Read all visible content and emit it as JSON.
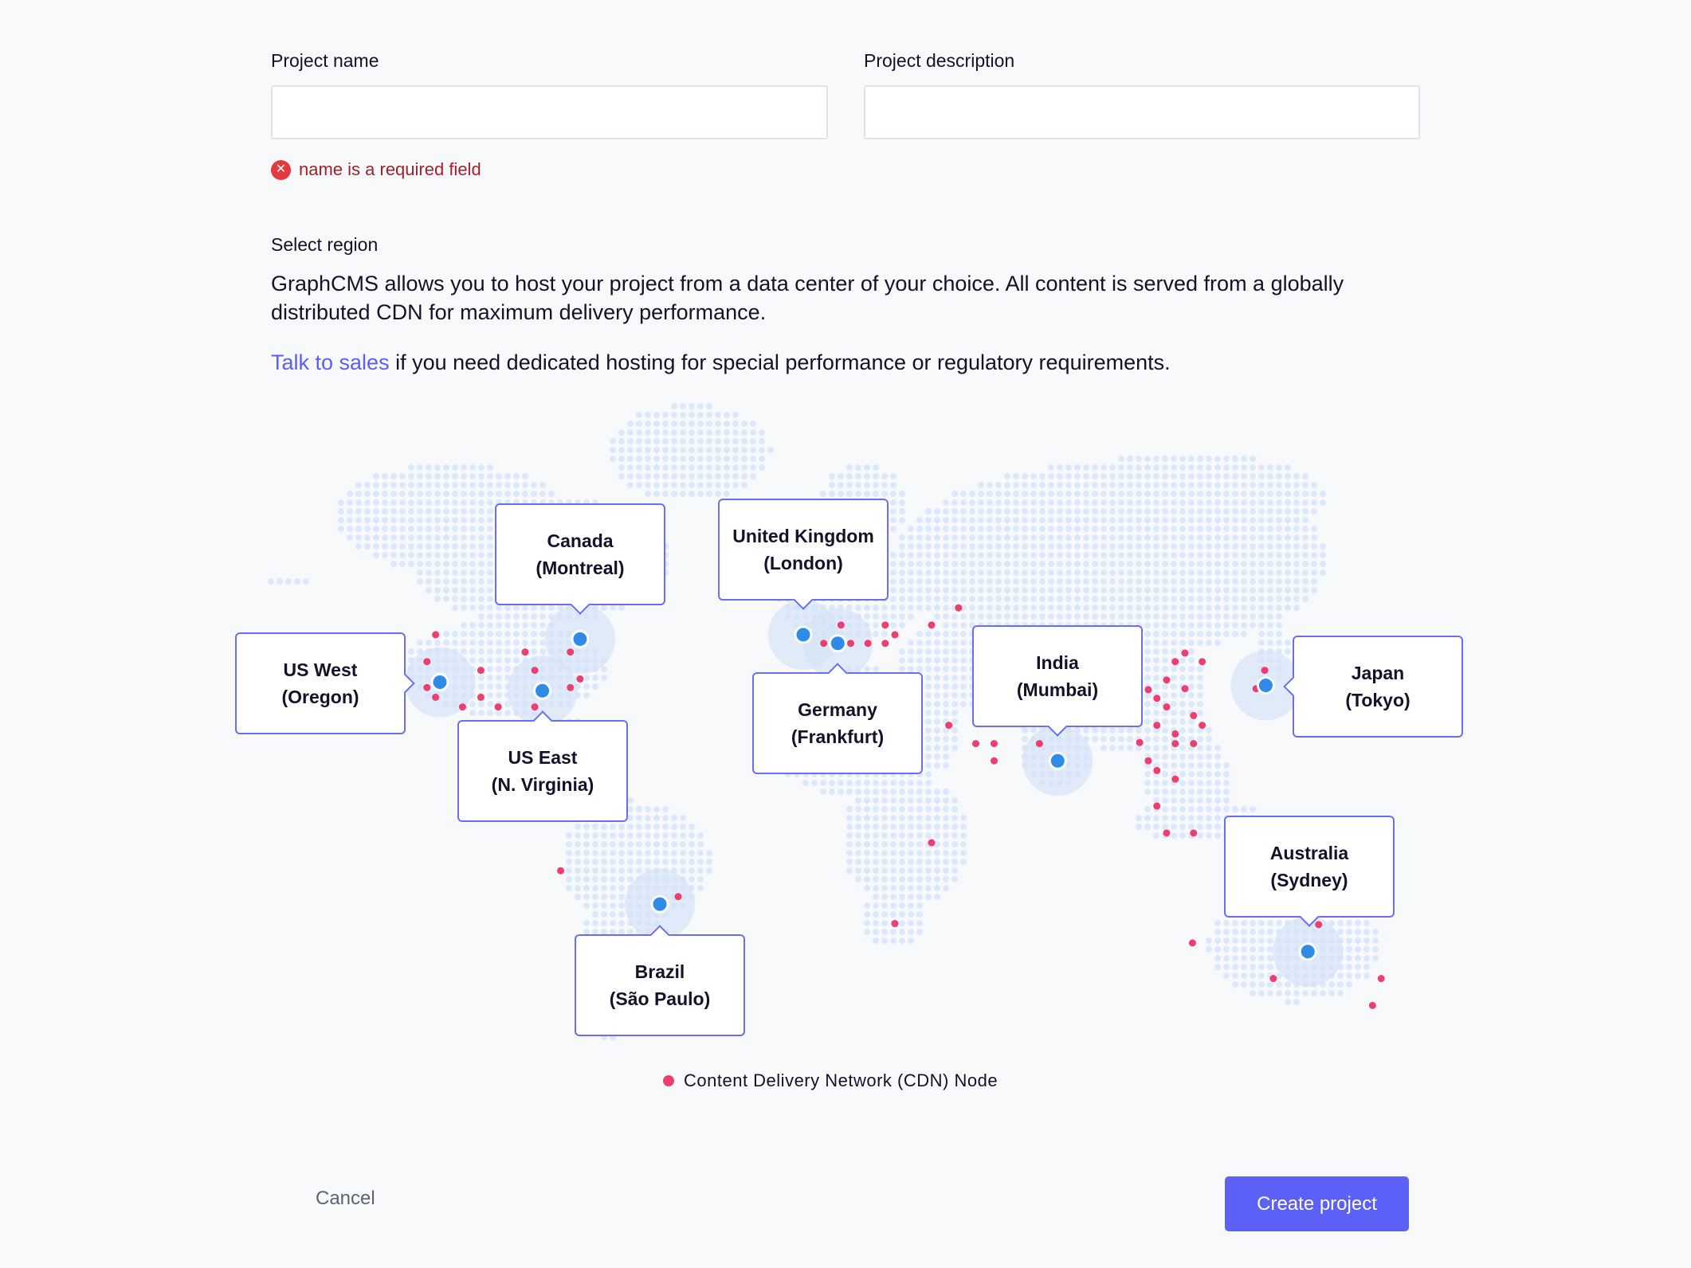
{
  "form": {
    "project_name_label": "Project name",
    "project_name_value": "",
    "project_name_placeholder": "",
    "project_description_label": "Project description",
    "project_description_value": "",
    "project_description_placeholder": "",
    "error_message": "name is a required field",
    "error_icon": "x-circle-icon"
  },
  "region": {
    "label": "Select region",
    "description": "GraphCMS allows you to host your project from a data center of your choice. All content is served from a globally distributed CDN for maximum delivery performance.",
    "sales_link": "Talk to sales",
    "sales_text": " if you need dedicated hosting for special performance or regulatory requirements.",
    "regions": [
      {
        "line1": "US West",
        "line2": "(Oregon)"
      },
      {
        "line1": "Canada",
        "line2": "(Montreal)"
      },
      {
        "line1": "United Kingdom",
        "line2": "(London)"
      },
      {
        "line1": "Germany",
        "line2": "(Frankfurt)"
      },
      {
        "line1": "India",
        "line2": "(Mumbai)"
      },
      {
        "line1": "Japan",
        "line2": "(Tokyo)"
      },
      {
        "line1": "US East",
        "line2": "(N. Virginia)"
      },
      {
        "line1": "Brazil",
        "line2": "(São Paulo)"
      },
      {
        "line1": "Australia",
        "line2": "(Sydney)"
      }
    ],
    "legend": "Content Delivery Network (CDN) Node",
    "colors": {
      "land": "#dce8fb",
      "cdn_node": "#ec3f70",
      "region_node": "#2f8ae8",
      "accent": "#5d60f7",
      "error": "#a2202c"
    }
  },
  "actions": {
    "cancel": "Cancel",
    "create": "Create project"
  }
}
